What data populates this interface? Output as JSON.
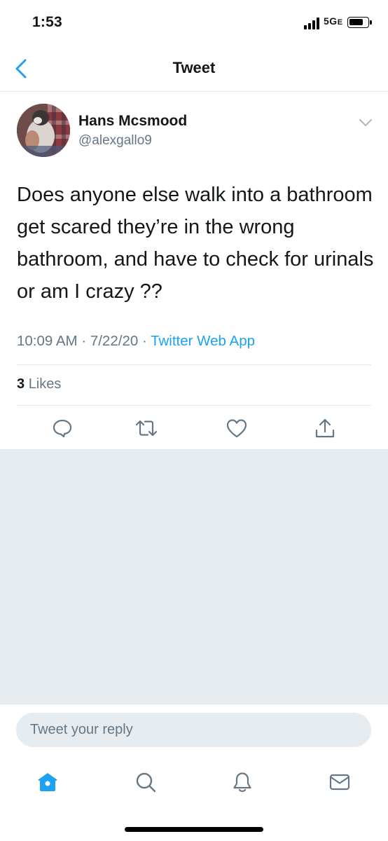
{
  "status_bar": {
    "time": "1:53",
    "network": "5G",
    "network_suffix": "E"
  },
  "nav": {
    "title": "Tweet"
  },
  "tweet": {
    "author_name": "Hans Mcsmood",
    "author_handle": "@alexgallo9",
    "text": "Does anyone else walk into a bathroom get scared they’re in the wrong bathroom, and have to check for urinals or am I crazy ??",
    "time": "10:09 AM",
    "date": "7/22/20",
    "source": "Twitter Web App",
    "likes_count": "3",
    "likes_label": "Likes"
  },
  "reply": {
    "placeholder": "Tweet your reply"
  },
  "icons": {
    "back": "chevron-left-icon",
    "more": "chevron-down-icon",
    "reply": "comment-icon",
    "retweet": "retweet-icon",
    "like": "heart-icon",
    "share": "share-icon",
    "home": "home-icon",
    "search": "search-icon",
    "notifications": "bell-icon",
    "messages": "mail-icon"
  },
  "colors": {
    "accent": "#1da1f2",
    "secondary_text": "#657786",
    "background_gray": "#e6ecf0",
    "icon_gray": "#657786"
  }
}
